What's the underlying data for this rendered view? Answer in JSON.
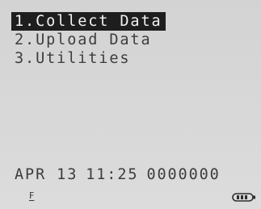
{
  "menu": {
    "items": [
      {
        "label": "1.Collect Data",
        "selected": true
      },
      {
        "label": "2.Upload Data",
        "selected": false
      },
      {
        "label": "3.Utilities",
        "selected": false
      }
    ]
  },
  "status": {
    "date": "APR 13",
    "time": "11:25",
    "counter": "0000000"
  },
  "indicators": {
    "mode_letter": "F",
    "battery_icon": "battery-icon"
  }
}
